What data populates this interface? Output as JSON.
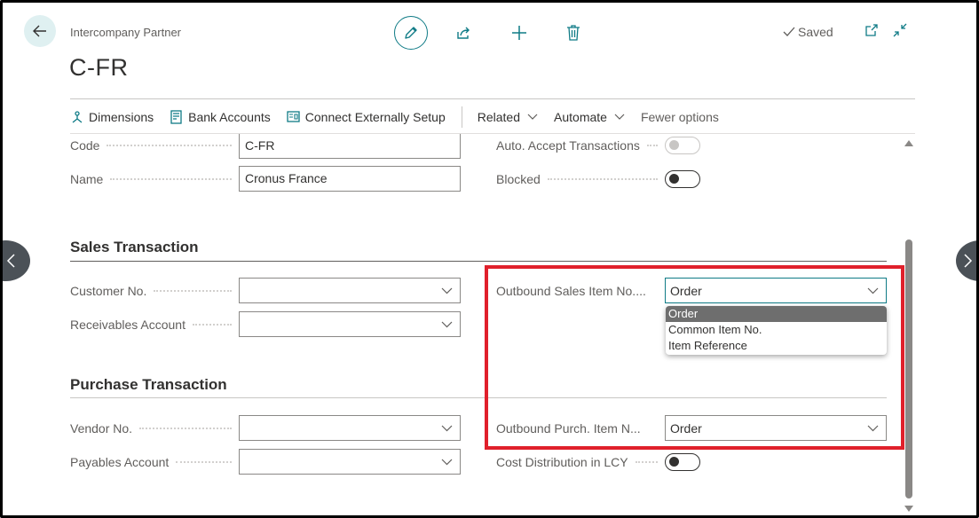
{
  "header": {
    "caption": "Intercompany Partner",
    "title": "C-FR",
    "saved_label": "Saved"
  },
  "actionbar": {
    "items": [
      {
        "label": "Dimensions",
        "icon": "dimensions-icon"
      },
      {
        "label": "Bank Accounts",
        "icon": "bank-accounts-icon"
      },
      {
        "label": "Connect Externally Setup",
        "icon": "connect-setup-icon"
      }
    ],
    "menus": [
      {
        "label": "Related"
      },
      {
        "label": "Automate"
      }
    ],
    "fewer_options": "Fewer options"
  },
  "general": {
    "code": {
      "label": "Code",
      "value": "C-FR"
    },
    "name": {
      "label": "Name",
      "value": "Cronus France"
    },
    "auto_accept": {
      "label": "Auto. Accept Transactions",
      "on": false,
      "disabled": true
    },
    "blocked": {
      "label": "Blocked",
      "on": false
    }
  },
  "sales": {
    "title": "Sales Transaction",
    "customer_no": {
      "label": "Customer No.",
      "value": ""
    },
    "receivables_account": {
      "label": "Receivables Account",
      "value": ""
    },
    "outbound_sales_item": {
      "label": "Outbound Sales Item No....",
      "value": "Order"
    }
  },
  "dropdown": {
    "options": [
      "Order",
      "Common Item No.",
      "Item Reference"
    ],
    "selected": "Order"
  },
  "purchase": {
    "title": "Purchase Transaction",
    "vendor_no": {
      "label": "Vendor No.",
      "value": ""
    },
    "payables_account": {
      "label": "Payables Account",
      "value": ""
    },
    "outbound_purch_item": {
      "label": "Outbound Purch. Item N...",
      "value": "Order"
    },
    "cost_distribution": {
      "label": "Cost Distribution in LCY",
      "on": false
    }
  },
  "colors": {
    "accent": "#0f7b86",
    "highlight": "#e0202b"
  }
}
